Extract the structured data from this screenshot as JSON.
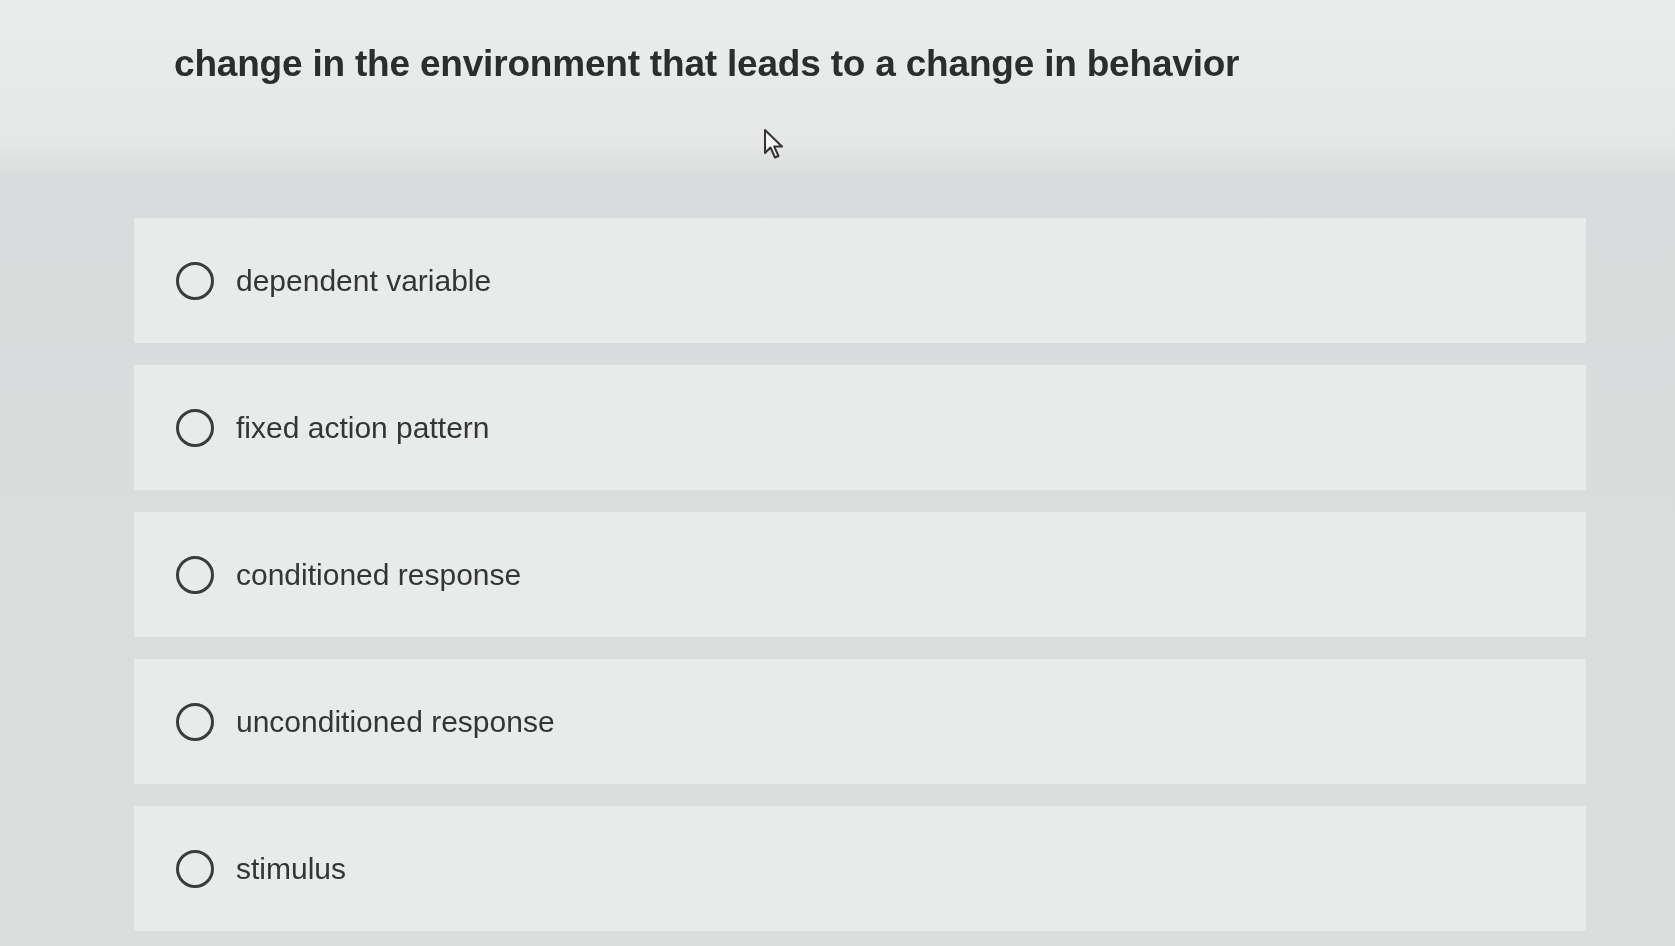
{
  "question": {
    "text": "change in the environment that leads to a change in behavior"
  },
  "options": [
    {
      "label": "dependent variable",
      "selected": false
    },
    {
      "label": "fixed action pattern",
      "selected": false
    },
    {
      "label": "conditioned response",
      "selected": false
    },
    {
      "label": "unconditioned response",
      "selected": false
    },
    {
      "label": "stimulus",
      "selected": false
    }
  ]
}
